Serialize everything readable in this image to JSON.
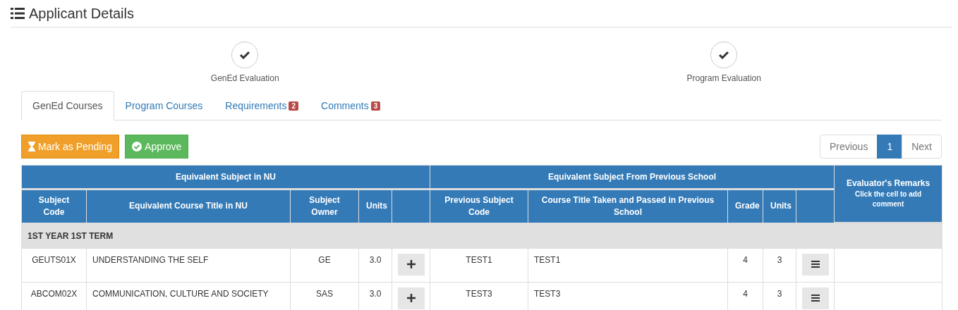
{
  "header": {
    "title": "Applicant Details"
  },
  "steps": [
    {
      "label": "GenEd Evaluation",
      "done": true
    },
    {
      "label": "Program Evaluation",
      "done": true
    }
  ],
  "tabs": [
    {
      "label": "GenEd Courses",
      "selected": true
    },
    {
      "label": "Program Courses",
      "selected": false
    },
    {
      "label": "Requirements",
      "selected": false,
      "badge": "2"
    },
    {
      "label": "Comments",
      "selected": false,
      "badge": "3"
    }
  ],
  "actions": [
    {
      "kind": "pending",
      "label": "Mark as Pending"
    },
    {
      "kind": "approve",
      "label": "Approve"
    }
  ],
  "pagination": [
    {
      "label": "Previous",
      "selected": false
    },
    {
      "label": "1",
      "selected": true
    },
    {
      "label": "Next",
      "selected": false
    }
  ],
  "table": {
    "groups": [
      "Equivalent Subject in NU",
      "Equivalent Subject From Previous School"
    ],
    "remarks_header": {
      "title": "Evaluator's Remarks",
      "hint": "Click the cell to add comment"
    },
    "columns": [
      "Subject Code",
      "Equivalent Course Title in NU",
      "Subject Owner",
      "Units",
      "Previous Subject Code",
      "Course Title Taken and Passed in Previous School",
      "Grade",
      "Units"
    ],
    "sections": [
      {
        "title": "1ST YEAR 1ST TERM",
        "rows": [
          {
            "code": "GEUTS01X",
            "title": "UNDERSTANDING THE SELF",
            "owner": "GE",
            "units": "3.0",
            "prev_code": "TEST1",
            "prev_title": "TEST1",
            "grade": "4",
            "prev_units": "3"
          },
          {
            "code": "ABCOM02X",
            "title": "COMMUNICATION, CULTURE AND SOCIETY",
            "owner": "SAS",
            "units": "3.0",
            "prev_code": "TEST3",
            "prev_title": "TEST3",
            "grade": "4",
            "prev_units": "3"
          }
        ]
      }
    ]
  }
}
